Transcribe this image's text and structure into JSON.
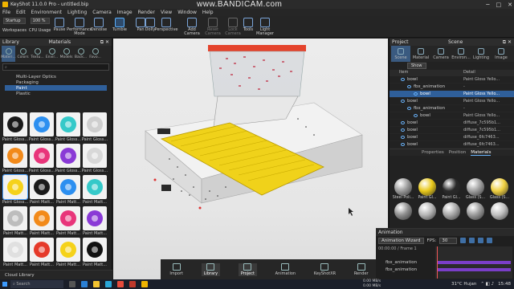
{
  "titlebar": {
    "title": "KeyShot 11.0.0 Pro - untitled.bip",
    "watermark": "www.BANDICAM.com"
  },
  "menu": [
    "File",
    "Edit",
    "Environment",
    "Lighting",
    "Camera",
    "Image",
    "Render",
    "View",
    "Window",
    "Help"
  ],
  "toolbar": {
    "workspace_value": "Startup",
    "cpu_value": "100 %",
    "workspaces_label": "Workspaces",
    "cpu_label": "CPU Usage",
    "pause_label": "Pause",
    "buttons": [
      {
        "label": "Performance Mode",
        "state": "normal"
      },
      {
        "label": "Denoise",
        "state": "normal"
      },
      {
        "label": "Tumble",
        "state": "active"
      },
      {
        "label": "Pan",
        "state": "normal"
      },
      {
        "label": "Dolly",
        "state": "normal"
      },
      {
        "label": "Perspective",
        "state": "normal"
      },
      {
        "label": "Add Camera",
        "state": "normal"
      },
      {
        "label": "Reset Camera",
        "state": "disabled"
      },
      {
        "label": "Lock Camera",
        "state": "disabled"
      },
      {
        "label": "Tools",
        "state": "normal"
      },
      {
        "label": "Light Manager",
        "state": "normal"
      }
    ]
  },
  "library": {
    "header": "Library",
    "subheader": "Materials",
    "tabs": [
      "Materi...",
      "Colors",
      "Textu...",
      "Envir...",
      "Models",
      "Back...",
      "Favo..."
    ],
    "search_placeholder": "",
    "tree": [
      {
        "label": "Multi-Layer Optics",
        "selected": false
      },
      {
        "label": "Packaging",
        "selected": false
      },
      {
        "label": "Paint",
        "selected": true
      },
      {
        "label": "Plastic",
        "selected": false
      }
    ],
    "thumbnails": [
      {
        "label": "Paint Gloss...",
        "color": "#1a1a1a"
      },
      {
        "label": "Paint Gloss...",
        "color": "#2c8ff0"
      },
      {
        "label": "Paint Gloss...",
        "color": "#35c9c9"
      },
      {
        "label": "Paint Gloss...",
        "color": "#cfcfcf"
      },
      {
        "label": "Paint Gloss...",
        "color": "#f28a1a"
      },
      {
        "label": "Paint Gloss...",
        "color": "#e8357a"
      },
      {
        "label": "Paint Gloss...",
        "color": "#8a3ad6"
      },
      {
        "label": "Paint Gloss...",
        "color": "#d8d8d8"
      },
      {
        "label": "Paint Gloss...",
        "color": "#f5d21a"
      },
      {
        "label": "Paint Matt...",
        "color": "#1a1a1a"
      },
      {
        "label": "Paint Matt...",
        "color": "#2c8ff0"
      },
      {
        "label": "Paint Matt...",
        "color": "#35c9c9"
      },
      {
        "label": "Paint Matt...",
        "color": "#bdbdbd"
      },
      {
        "label": "Paint Matt...",
        "color": "#f28a1a"
      },
      {
        "label": "Paint Matt...",
        "color": "#e8357a"
      },
      {
        "label": "Paint Matt...",
        "color": "#8a3ad6"
      },
      {
        "label": "Paint Matt...",
        "color": "#e0e0e0"
      },
      {
        "label": "Paint Matt...",
        "color": "#e53a2a"
      },
      {
        "label": "Paint Matt...",
        "color": "#f5d21a"
      },
      {
        "label": "Paint Matt...",
        "color": "#111111"
      }
    ],
    "cloud_label": "Cloud Library"
  },
  "bottombar": [
    "Import",
    "Library",
    "Project",
    "Animation",
    "KeyShotXR",
    "Render"
  ],
  "project": {
    "header": "Project",
    "subheader": "Scene",
    "tabs": [
      "Scene",
      "Material",
      "Camera",
      "Environ...",
      "Lighting",
      "Image"
    ],
    "show_label": "Show",
    "columns": [
      "Item",
      "Detail"
    ],
    "rows": [
      {
        "name": "bowl",
        "detail": "Paint Gloss Yello...",
        "indent": 1,
        "selected": false
      },
      {
        "name": "fbx_animation",
        "detail": "-",
        "indent": 2,
        "selected": false
      },
      {
        "name": "bowl",
        "detail": "Paint Gloss Yello...",
        "indent": 3,
        "selected": true
      },
      {
        "name": "bowl",
        "detail": "Paint Gloss Yello...",
        "indent": 1,
        "selected": false
      },
      {
        "name": "fbx_animation",
        "detail": "-",
        "indent": 2,
        "selected": false
      },
      {
        "name": "bowl",
        "detail": "Paint Gloss Yello...",
        "indent": 3,
        "selected": false
      },
      {
        "name": "bowl",
        "detail": "diffuse_7c595b1...",
        "indent": 1,
        "selected": false
      },
      {
        "name": "bowl",
        "detail": "diffuse_7c595b1...",
        "indent": 1,
        "selected": false
      },
      {
        "name": "bowl",
        "detail": "diffuse_6fc7463...",
        "indent": 1,
        "selected": false
      },
      {
        "name": "bowl",
        "detail": "diffuse_6fc7463...",
        "indent": 1,
        "selected": false
      }
    ],
    "prop_tabs": [
      "Properties",
      "Position",
      "Materials"
    ],
    "materials": [
      {
        "label": "Steel Poli...",
        "color": "#9a9a9a"
      },
      {
        "label": "Paint Gl...",
        "color": "#e8c81a"
      },
      {
        "label": "Paint Gl...",
        "color": "#2a2a2a"
      },
      {
        "label": "Glass (S...",
        "color": "#9f9f9f"
      },
      {
        "label": "Glass (S...",
        "color": "#f0d040"
      },
      {
        "label": "",
        "color": "#8e8e8e"
      },
      {
        "label": "",
        "color": "#b5b5b5"
      },
      {
        "label": "",
        "color": "#a8a8a8"
      },
      {
        "label": "",
        "color": "#9a9a9a"
      },
      {
        "label": "",
        "color": "#c0c0c0"
      }
    ]
  },
  "animation": {
    "header": "Animation",
    "wizard_label": "Animation Wizard",
    "fps_label": "FPS:",
    "fps_value": "30",
    "frame_info": "00:00:00 / Frame 1",
    "tracks": [
      "fbx_animation",
      "fbx_animation"
    ]
  },
  "taskbar": {
    "search_placeholder": "Search",
    "weather": "31°C Hujan",
    "time": "15:48",
    "net_up": "0.00 MB/s",
    "net_down": "0.00 MB/s"
  },
  "colors": {
    "accent": "#3a5a80",
    "selection": "#2f5f9a",
    "yellow_tray": "#f0d21a"
  }
}
